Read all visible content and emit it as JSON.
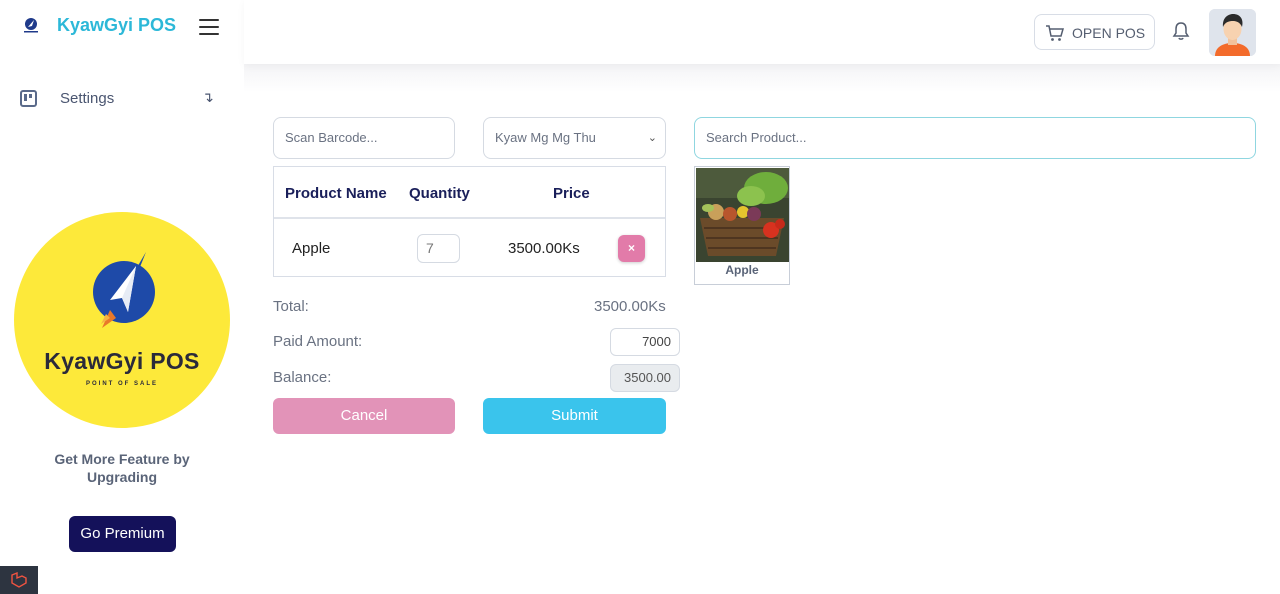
{
  "app": {
    "title": "KyawGyi POS"
  },
  "sidebar": {
    "items": [
      {
        "label": "Settings",
        "icon": "board-icon"
      }
    ],
    "promo": {
      "logo_title": "KyawGyi POS",
      "logo_subtitle": "POINT OF SALE",
      "upgrade_text": "Get More Feature by Upgrading",
      "premium_button": "Go Premium"
    }
  },
  "header": {
    "open_pos_label": "OPEN POS"
  },
  "pos": {
    "barcode_placeholder": "Scan Barcode...",
    "customer_selected": "Kyaw Mg Mg Thu",
    "search_placeholder": "Search Product...",
    "table": {
      "headers": [
        "Product Name",
        "Quantity",
        "Price"
      ],
      "rows": [
        {
          "name": "Apple",
          "quantity": "7",
          "price": "3500.00Ks",
          "remove": "×"
        }
      ]
    },
    "summary": {
      "total_label": "Total:",
      "total_value": "3500.00Ks",
      "paid_label": "Paid Amount:",
      "paid_value": "7000",
      "balance_label": "Balance:",
      "balance_value": "3500.00"
    },
    "cancel_label": "Cancel",
    "submit_label": "Submit",
    "products": [
      {
        "name": "Apple"
      }
    ]
  },
  "colors": {
    "brand": "#2cb8d8",
    "premium": "#14115a",
    "cancel": "#e293b8",
    "submit": "#3ac4ec",
    "remove": "#e27ba9",
    "promo_bg": "#fde93a"
  }
}
